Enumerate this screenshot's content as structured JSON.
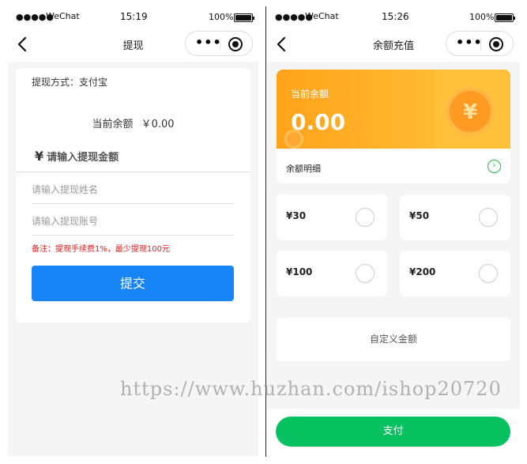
{
  "left": {
    "status": {
      "dots": "●●●●●",
      "carrier": "WeChat",
      "time": "15:19",
      "battery": "100%"
    },
    "nav": {
      "title": "提现",
      "more_icon": "ellipsis-icon",
      "close_icon": "target-icon"
    },
    "method": "提现方式：支付宝",
    "balance_label": "当前余额",
    "balance_value": "￥0.00",
    "amount_currency": "¥",
    "amount_placeholder": "请输入提现金额",
    "name_placeholder": "请输入提现姓名",
    "account_placeholder": "请输入提现账号",
    "note": "备注：提现手续费1%，最少提现100元",
    "submit_label": "提交",
    "submit_color": "#1784f8"
  },
  "right": {
    "status": {
      "dots": "●●●●●",
      "carrier": "WeChat",
      "time": "15:26",
      "battery": "100%"
    },
    "nav": {
      "title": "余额充值"
    },
    "balance_label": "当前余额",
    "balance_value": "0.00",
    "coin_symbol": "¥",
    "detail_label": "余额明细",
    "amounts": [
      "¥30",
      "¥50",
      "¥100",
      "¥200"
    ],
    "custom_label": "自定义金额",
    "pay_label": "支付",
    "pay_color": "#08c160",
    "accent_color": "#ffa21a"
  },
  "watermark": "https://www.huzhan.com/ishop20720"
}
